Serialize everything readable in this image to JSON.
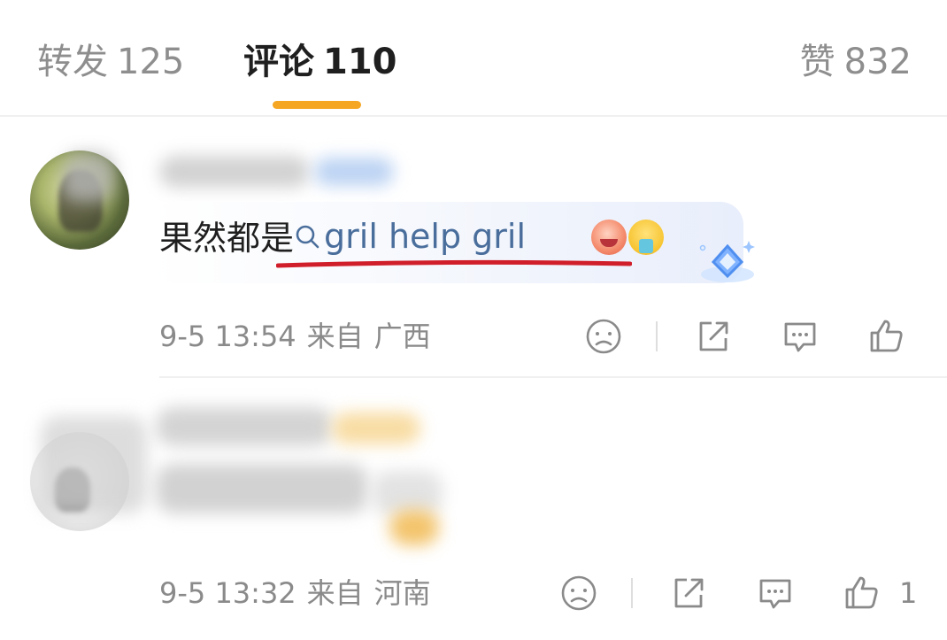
{
  "tabs": [
    {
      "label": "转发",
      "count": "125"
    },
    {
      "label": "评论",
      "count": "110"
    },
    {
      "label": "赞",
      "count": "832"
    }
  ],
  "comments": [
    {
      "text_prefix": "果然都是",
      "tag_text": "gril help gril",
      "time": "9-5 13:54",
      "from_label": "来自",
      "location": "广西"
    },
    {
      "time": "9-5 13:32",
      "from_label": "来自",
      "location": "河南",
      "like_count": "1"
    }
  ],
  "colors": {
    "accent": "#f5a623",
    "link": "#4a6e9c",
    "annotation_underline": "#d01f2a",
    "meta_text": "#8a8a8a"
  },
  "icons": [
    "search-icon",
    "dislike-face-icon",
    "share-icon",
    "comment-icon",
    "like-thumb-icon",
    "diamond-badge-icon"
  ]
}
